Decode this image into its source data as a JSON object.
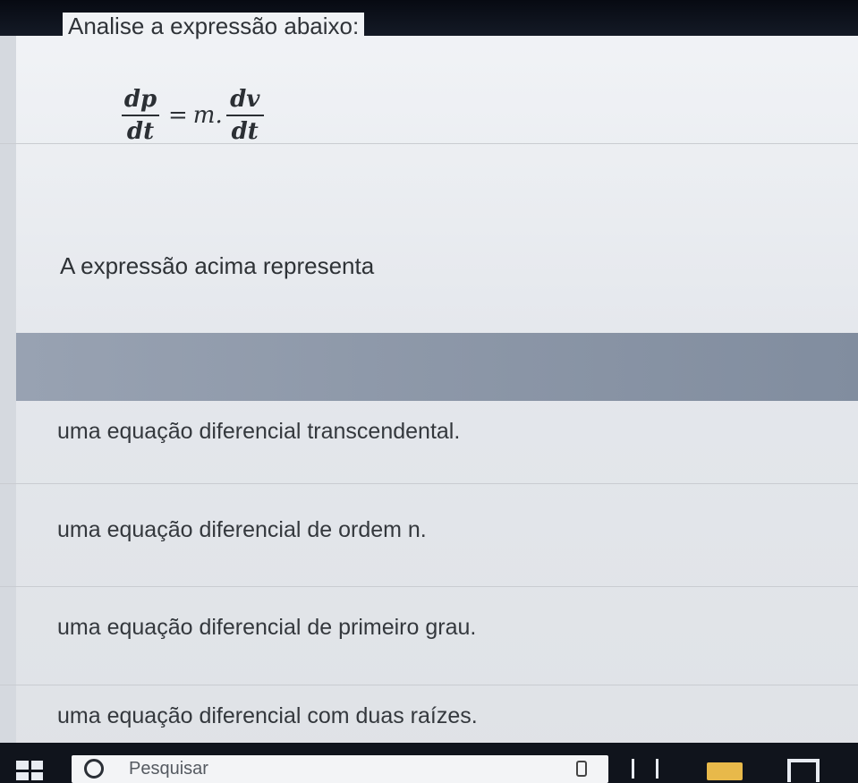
{
  "question": {
    "title": "Analise a expressão abaixo:",
    "formula": {
      "left_numerator": "dp",
      "left_denominator": "dt",
      "equals": "=",
      "multiplier": "m.",
      "right_numerator": "dv",
      "right_denominator": "dt"
    },
    "prompt": "A expressão acima representa"
  },
  "options": [
    {
      "label": "uma equação diferencial transcendental."
    },
    {
      "label": "uma equação diferencial de ordem n."
    },
    {
      "label": "uma equação diferencial de primeiro grau."
    },
    {
      "label": "uma equação diferencial com duas raízes."
    }
  ],
  "taskbar": {
    "search_placeholder": "Pesquisar",
    "icons": [
      "windows-start-icon",
      "search-circle-icon",
      "microphone-icon",
      "task-view-icon",
      "file-explorer-folder-icon",
      "store-bag-icon"
    ]
  },
  "colors": {
    "options_header": "#8a95a6",
    "taskbar": "#10141c",
    "folder": "#e8b94a"
  }
}
